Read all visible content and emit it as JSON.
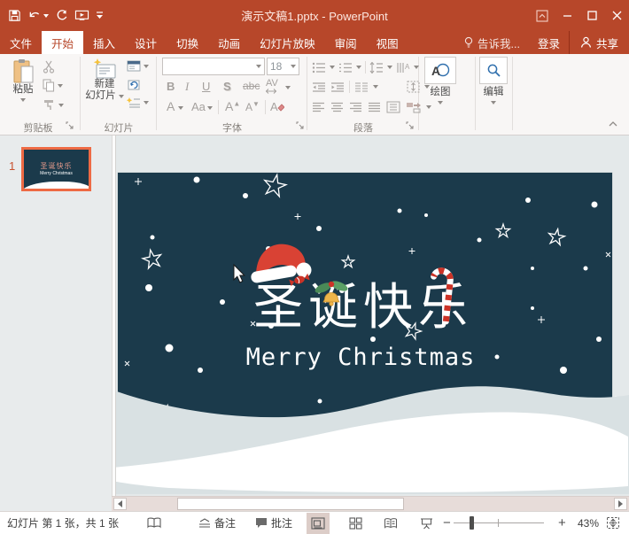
{
  "titlebar": {
    "title": "演示文稿1.pptx - PowerPoint"
  },
  "tabs": [
    "文件",
    "开始",
    "插入",
    "设计",
    "切换",
    "动画",
    "幻灯片放映",
    "审阅",
    "视图"
  ],
  "tabbar": {
    "tellme": "告诉我...",
    "signin": "登录",
    "share": "共享"
  },
  "ribbon": {
    "clipboard": {
      "label": "剪贴板",
      "paste": "粘贴"
    },
    "slides": {
      "label": "幻灯片",
      "new_line1": "新建",
      "new_line2": "幻灯片"
    },
    "font": {
      "label": "字体",
      "size": "18",
      "bold": "B",
      "italic": "I",
      "underline": "U",
      "shadow": "S",
      "strike": "abc",
      "spacing": "AV",
      "color": "A",
      "case": "Aa",
      "grow": "A",
      "shrink": "A"
    },
    "paragraph": {
      "label": "段落"
    },
    "drawing": {
      "label": "绘图"
    },
    "editing": {
      "label": "编辑"
    }
  },
  "slides_panel": {
    "slide_number": "1"
  },
  "slide": {
    "title": "圣诞快乐",
    "subtitle": "Merry Christmas"
  },
  "statusbar": {
    "slide_info": "幻灯片 第 1 张，共 1 张",
    "notes": "备注",
    "comments": "批注",
    "zoom_out": "−",
    "zoom_in": "+",
    "zoom_level": "43%"
  },
  "colors": {
    "accent": "#B7472A",
    "slide_background": "#1b3a4b",
    "selection_border": "#ee6a44",
    "snow_wave_gray": "#d9e1e3"
  }
}
